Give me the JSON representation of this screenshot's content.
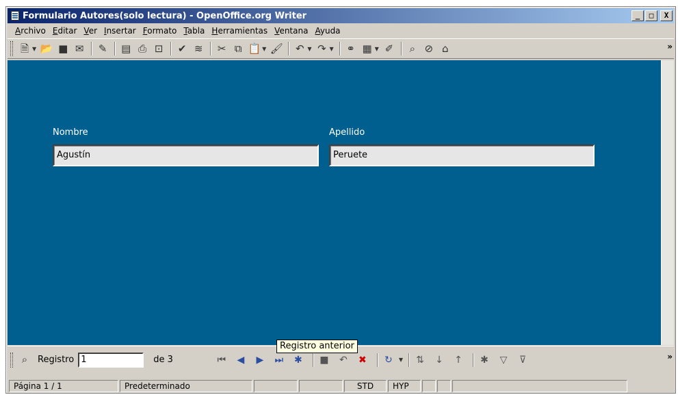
{
  "window": {
    "title": "Formulario Autores(solo lectura) - OpenOffice.org Writer",
    "minimize": "_",
    "maximize": "□",
    "close": "X"
  },
  "menu": [
    "Archivo",
    "Editar",
    "Ver",
    "Insertar",
    "Formato",
    "Tabla",
    "Herramientas",
    "Ventana",
    "Ayuda"
  ],
  "toolbar": {
    "icons": [
      {
        "name": "new-icon",
        "glyph": "🗎",
        "drop": true
      },
      {
        "name": "open-icon",
        "glyph": "📂"
      },
      {
        "name": "save-icon",
        "glyph": "■"
      },
      {
        "name": "email-icon",
        "glyph": "✉"
      },
      {
        "sep": true
      },
      {
        "name": "edit-file-icon",
        "glyph": "✎"
      },
      {
        "sep": true
      },
      {
        "name": "export-pdf-icon",
        "glyph": "▤"
      },
      {
        "name": "print-icon",
        "glyph": "⎙"
      },
      {
        "name": "page-preview-icon",
        "glyph": "⊡"
      },
      {
        "sep": true
      },
      {
        "name": "spellcheck-icon",
        "glyph": "✔"
      },
      {
        "name": "autospellcheck-icon",
        "glyph": "≋"
      },
      {
        "sep": true
      },
      {
        "name": "cut-icon",
        "glyph": "✂"
      },
      {
        "name": "copy-icon",
        "glyph": "⧉"
      },
      {
        "name": "paste-icon",
        "glyph": "📋",
        "drop": true
      },
      {
        "name": "format-paintbrush-icon",
        "glyph": "🖌"
      },
      {
        "sep": true
      },
      {
        "name": "undo-icon",
        "glyph": "↶",
        "drop": true
      },
      {
        "name": "redo-icon",
        "glyph": "↷",
        "drop": true
      },
      {
        "sep": true
      },
      {
        "name": "hyperlink-icon",
        "glyph": "⚭"
      },
      {
        "name": "table-icon",
        "glyph": "▦",
        "drop": true
      },
      {
        "name": "draw-functions-icon",
        "glyph": "✐"
      },
      {
        "sep": true
      },
      {
        "name": "find-replace-icon",
        "glyph": "⌕"
      },
      {
        "name": "navigator-icon",
        "glyph": "⊘"
      },
      {
        "name": "gallery-icon",
        "glyph": "⌂"
      }
    ],
    "more": "»"
  },
  "form": {
    "nombre_label": "Nombre",
    "nombre_value": "Agustín",
    "apellido_label": "Apellido",
    "apellido_value": "Peruete",
    "background": "#005f8f"
  },
  "navigation": {
    "registro_label": "Registro",
    "registro_value": "1",
    "total_label": "de 3",
    "tooltip": "Registro anterior",
    "more": "»"
  },
  "status": {
    "page": "Página  1 / 1",
    "style": "Predeterminado",
    "mode": "STD",
    "hyphen": "HYP"
  }
}
